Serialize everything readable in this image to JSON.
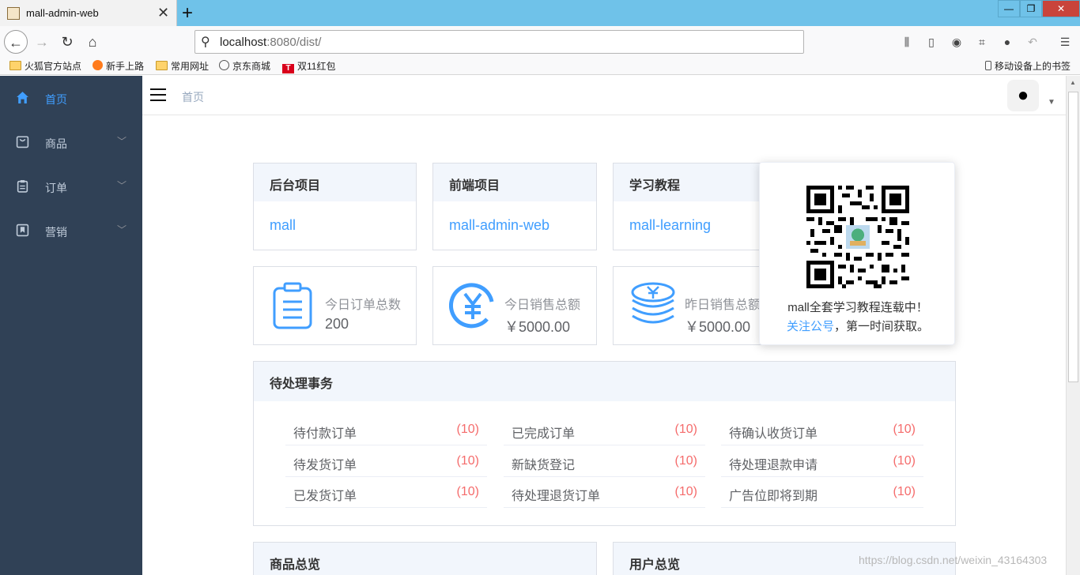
{
  "browser": {
    "tab_title": "mall-admin-web",
    "url_host": "localhost",
    "url_rest": ":8080/dist/",
    "bookmarks": [
      "火狐官方站点",
      "新手上路",
      "常用网址",
      "京东商城",
      "双11红包"
    ],
    "mobile_bookmarks": "移动设备上的书签"
  },
  "sidebar": {
    "items": [
      {
        "label": "首页",
        "icon": "home-icon"
      },
      {
        "label": "商品",
        "icon": "bag-icon"
      },
      {
        "label": "订单",
        "icon": "clipboard-icon"
      },
      {
        "label": "营销",
        "icon": "bookmark-icon"
      }
    ]
  },
  "header": {
    "breadcrumb": "首页"
  },
  "projects": [
    {
      "title": "后台项目",
      "link": "mall"
    },
    {
      "title": "前端项目",
      "link": "mall-admin-web"
    },
    {
      "title": "学习教程",
      "link": "mall-learning"
    }
  ],
  "stats": [
    {
      "title": "今日订单总数",
      "value": "200"
    },
    {
      "title": "今日销售总额",
      "value": "￥5000.00"
    },
    {
      "title": "昨日销售总额",
      "value": "￥5000.00"
    }
  ],
  "pending": {
    "title": "待处理事务",
    "items": [
      {
        "label": "待付款订单",
        "count": "(10)"
      },
      {
        "label": "已完成订单",
        "count": "(10)"
      },
      {
        "label": "待确认收货订单",
        "count": "(10)"
      },
      {
        "label": "待发货订单",
        "count": "(10)"
      },
      {
        "label": "新缺货登记",
        "count": "(10)"
      },
      {
        "label": "待处理退款申请",
        "count": "(10)"
      },
      {
        "label": "已发货订单",
        "count": "(10)"
      },
      {
        "label": "待处理退货订单",
        "count": "(10)"
      },
      {
        "label": "广告位即将到期",
        "count": "(10)"
      }
    ]
  },
  "overview": {
    "goods": "商品总览",
    "users": "用户总览"
  },
  "popover": {
    "line1": "mall全套学习教程连载中！",
    "link": "关注公号",
    "line2_rest": "，第一时间获取。"
  },
  "watermark": "https://blog.csdn.net/weixin_43164303",
  "colors": {
    "accent": "#409eff",
    "sidebar": "#304156",
    "danger": "#f56c6c"
  }
}
